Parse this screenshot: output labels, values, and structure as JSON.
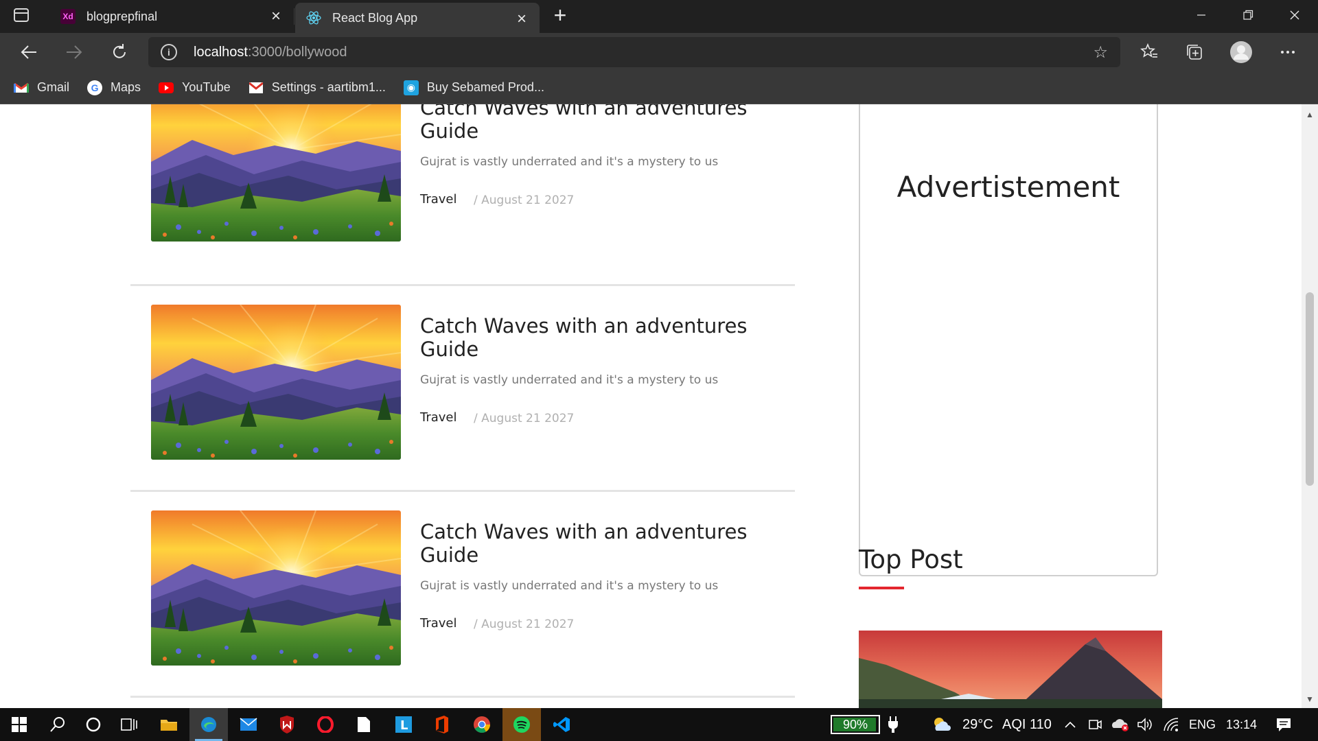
{
  "browser": {
    "tabs": [
      {
        "title": "blogprepfinal",
        "icon": "adobe-xd-icon"
      },
      {
        "title": "React Blog App",
        "icon": "react-icon",
        "active": true
      }
    ],
    "url_host": "localhost",
    "url_path": ":3000/bollywood",
    "bookmarks": [
      {
        "label": "Gmail",
        "icon": "gmail-icon"
      },
      {
        "label": "Maps",
        "icon": "google-icon"
      },
      {
        "label": "YouTube",
        "icon": "youtube-icon"
      },
      {
        "label": "Settings - aartibm1...",
        "icon": "gmail-icon"
      },
      {
        "label": "Buy Sebamed Prod...",
        "icon": "store-icon"
      }
    ]
  },
  "posts": [
    {
      "title": "Catch Waves with an adventures Guide",
      "excerpt": "Gujrat is vastly underrated and it's a mystery to us",
      "category": "Travel",
      "date": "/ August 21 2027"
    },
    {
      "title": "Catch Waves with an adventures Guide",
      "excerpt": "Gujrat is vastly underrated and it's a mystery to us",
      "category": "Travel",
      "date": "/ August 21 2027"
    },
    {
      "title": "Catch Waves with an adventures Guide",
      "excerpt": "Gujrat is vastly underrated and it's a mystery to us",
      "category": "Travel",
      "date": "/ August 21 2027"
    }
  ],
  "sidebar": {
    "ad_title": "Advertistement",
    "top_post_heading": "Top Post"
  },
  "taskbar": {
    "battery": "90%",
    "weather": "29°C",
    "aqi": "AQI 110",
    "language": "ENG",
    "time": "13:14"
  },
  "colors": {
    "accent_underline": "#e3262e",
    "chrome_dark": "#202020",
    "chrome_mid": "#383838"
  }
}
